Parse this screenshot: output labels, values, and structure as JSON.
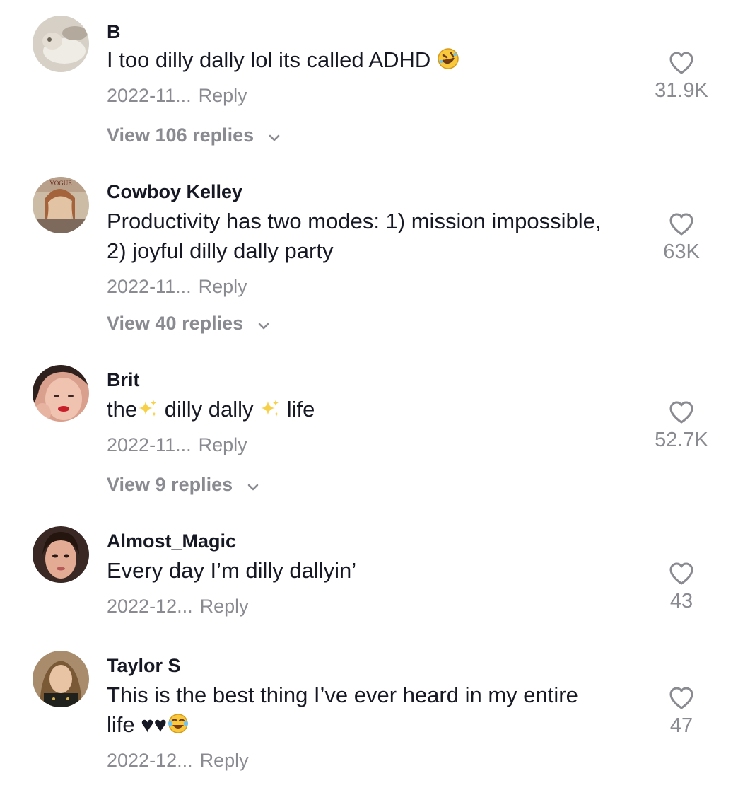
{
  "comments": [
    {
      "username": "B",
      "text": "I too dilly dally lol its called ADHD",
      "date": "2022-11...",
      "reply_label": "Reply",
      "view_replies": "View 106 replies",
      "likes": "31.9K",
      "avatar_colors": [
        "#d8d2c8",
        "#a9a196"
      ]
    },
    {
      "username": "Cowboy Kelley",
      "text_line1": "Productivity has two modes: 1) mission impossible,",
      "text_line2": "2) joyful dilly dally party",
      "date": "2022-11...",
      "reply_label": "Reply",
      "view_replies": "View 40 replies",
      "likes": "63K",
      "avatar_colors": [
        "#c7b7a3",
        "#8a5a3c"
      ]
    },
    {
      "username": "Brit",
      "text_a": "the",
      "text_b": " dilly dally ",
      "text_c": " life",
      "date": "2022-11...",
      "reply_label": "Reply",
      "view_replies": "View 9 replies",
      "likes": "52.7K",
      "avatar_colors": [
        "#e9b5a4",
        "#3a2a26"
      ]
    },
    {
      "username": "Almost_Magic",
      "text": "Every day I’m dilly dallyin’",
      "date": "2022-12...",
      "reply_label": "Reply",
      "likes": "43",
      "avatar_colors": [
        "#d9a48e",
        "#2b1e1a"
      ]
    },
    {
      "username": "Taylor S",
      "text_line1": "This is the best thing I’ve ever heard in my entire",
      "text_line2": "life ♥♥",
      "date": "2022-12...",
      "reply_label": "Reply",
      "likes": "47",
      "avatar_colors": [
        "#b89a7a",
        "#2d2a26"
      ]
    }
  ],
  "icons": {
    "like": "heart-outline-icon",
    "expand": "chevron-down-icon"
  },
  "colors": {
    "text": "#161823",
    "muted": "#8a8b91"
  }
}
